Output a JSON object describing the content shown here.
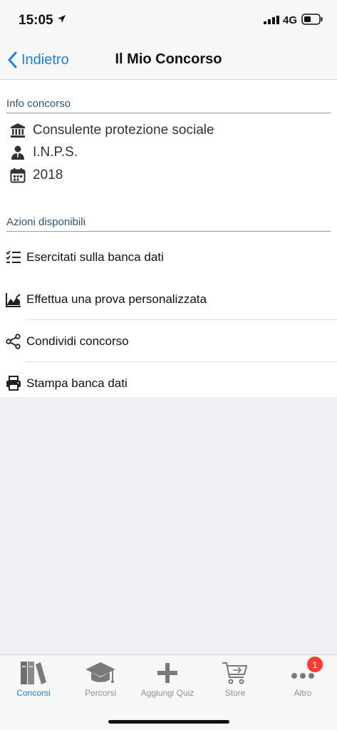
{
  "status": {
    "time": "15:05",
    "network": "4G"
  },
  "nav": {
    "back_label": "Indietro",
    "title": "Il Mio Concorso"
  },
  "info": {
    "header": "Info concorso",
    "items": [
      {
        "icon": "institution-icon",
        "text": "Consulente protezione sociale"
      },
      {
        "icon": "person-icon",
        "text": "I.N.P.S."
      },
      {
        "icon": "calendar-icon",
        "text": "2018"
      }
    ]
  },
  "actions": {
    "header": "Azioni disponibili",
    "items": [
      {
        "icon": "checklist-icon",
        "label": "Esercitati sulla banca dati"
      },
      {
        "icon": "line-chart-icon",
        "label": "Effettua una prova personalizzata"
      },
      {
        "icon": "share-icon",
        "label": "Condividi concorso"
      },
      {
        "icon": "printer-icon",
        "label": "Stampa banca dati"
      }
    ]
  },
  "tabs": [
    {
      "icon": "books-icon",
      "label": "Concorsi",
      "active": true
    },
    {
      "icon": "graduation-cap-icon",
      "label": "Percorsi",
      "active": false
    },
    {
      "icon": "plus-icon",
      "label": "Aggiungi Quiz",
      "active": false
    },
    {
      "icon": "cart-icon",
      "label": "Store",
      "active": false
    },
    {
      "icon": "more-icon",
      "label": "Altro",
      "active": false,
      "badge": "1"
    }
  ],
  "colors": {
    "accent": "#1a7ff0",
    "section_header": "#2f5273",
    "badge": "#ff3b30"
  }
}
